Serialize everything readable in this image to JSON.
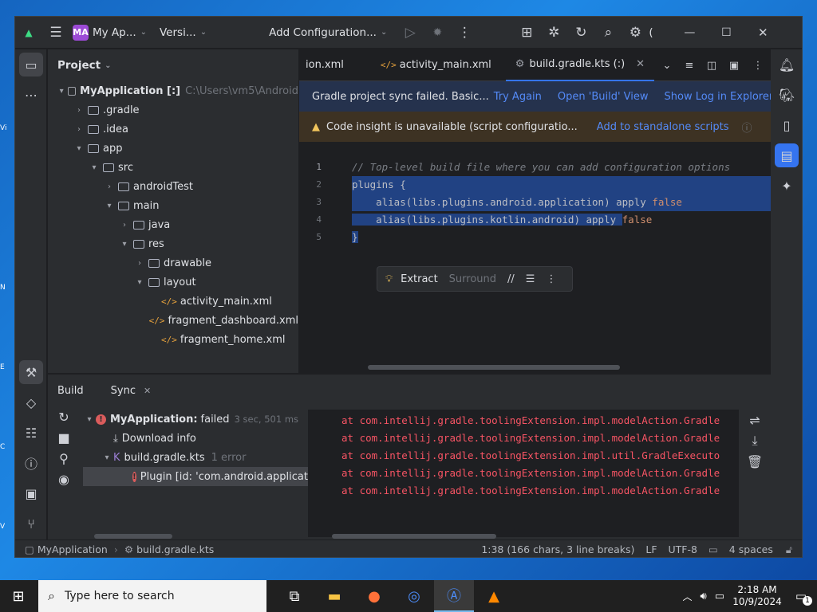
{
  "titlebar": {
    "project_badge": "MA",
    "project_name": "My Ap...",
    "vcs": "Versi...",
    "run_config": "Add Configuration...",
    "extra": "("
  },
  "project_panel": {
    "title": "Project",
    "tree": [
      {
        "label": "MyApplication [:]",
        "path": "C:\\Users\\vm5\\Android",
        "kind": "module",
        "arrow": "▾",
        "indent": 0
      },
      {
        "label": ".gradle",
        "kind": "folder",
        "arrow": "›",
        "indent": 1
      },
      {
        "label": ".idea",
        "kind": "folder",
        "arrow": "›",
        "indent": 1
      },
      {
        "label": "app",
        "kind": "folder",
        "arrow": "▾",
        "indent": 1
      },
      {
        "label": "src",
        "kind": "folder",
        "arrow": "▾",
        "indent": 2
      },
      {
        "label": "androidTest",
        "kind": "folder",
        "arrow": "›",
        "indent": 3
      },
      {
        "label": "main",
        "kind": "folder",
        "arrow": "▾",
        "indent": 3
      },
      {
        "label": "java",
        "kind": "folder",
        "arrow": "›",
        "indent": 4
      },
      {
        "label": "res",
        "kind": "folder",
        "arrow": "▾",
        "indent": 4
      },
      {
        "label": "drawable",
        "kind": "folder",
        "arrow": "›",
        "indent": 5
      },
      {
        "label": "layout",
        "kind": "folder",
        "arrow": "▾",
        "indent": 5
      },
      {
        "label": "activity_main.xml",
        "kind": "xml",
        "arrow": "",
        "indent": 6
      },
      {
        "label": "fragment_dashboard.xml",
        "kind": "xml",
        "arrow": "",
        "indent": 6
      },
      {
        "label": "fragment_home.xml",
        "kind": "xml",
        "arrow": "",
        "indent": 6
      }
    ]
  },
  "editor": {
    "tabs": [
      "ion.xml",
      "activity_main.xml",
      "build.gradle.kts (:)"
    ],
    "banner_sync": {
      "text": "Gradle project sync failed. Basic...",
      "links": [
        "Try Again",
        "Open 'Build' View",
        "Show Log in Explorer"
      ]
    },
    "banner_insight": {
      "text": "Code insight is unavailable (script configuratio...",
      "link": "Add to standalone scripts"
    },
    "line_numbers": [
      "1",
      "2",
      "3",
      "4",
      "5"
    ],
    "code": {
      "l1": "// Top-level build file where you can add configuration options",
      "l2": "plugins {",
      "l3a": "    alias(libs.plugins.android.application) apply ",
      "l3b": "false",
      "l4a": "    alias(libs.plugins.kotlin.android) apply ",
      "l4b": "false",
      "l5": "}"
    },
    "popup": {
      "extract": "Extract",
      "surround": "Surround"
    }
  },
  "build_panel": {
    "tabs": [
      "Build",
      "Sync"
    ],
    "tree": {
      "root": "MyApplication:",
      "root_status": "failed",
      "root_time": "3 sec, 501 ms",
      "download": "Download info",
      "file": "build.gradle.kts",
      "file_errors": "1 error",
      "plugin": "Plugin [id: 'com.android.applicat"
    },
    "console": [
      "at com.intellij.gradle.toolingExtension.impl.modelAction.Gradle",
      "at com.intellij.gradle.toolingExtension.impl.modelAction.Gradle",
      "at com.intellij.gradle.toolingExtension.impl.util.GradleExecuto",
      "at com.intellij.gradle.toolingExtension.impl.modelAction.Gradle",
      "at com.intellij.gradle.toolingExtension.impl.modelAction.Gradle"
    ]
  },
  "statusbar": {
    "crumb_project": "MyApplication",
    "crumb_file": "build.gradle.kts",
    "position": "1:38 (166 chars, 3 line breaks)",
    "line_sep": "LF",
    "encoding": "UTF-8",
    "indent": "4 spaces"
  },
  "taskbar": {
    "search_placeholder": "Type here to search",
    "time": "2:18 AM",
    "date": "10/9/2024",
    "notif_count": "1"
  },
  "colors": {
    "accent": "#3574f0",
    "error": "#db5c5c",
    "selection": "#214283"
  }
}
